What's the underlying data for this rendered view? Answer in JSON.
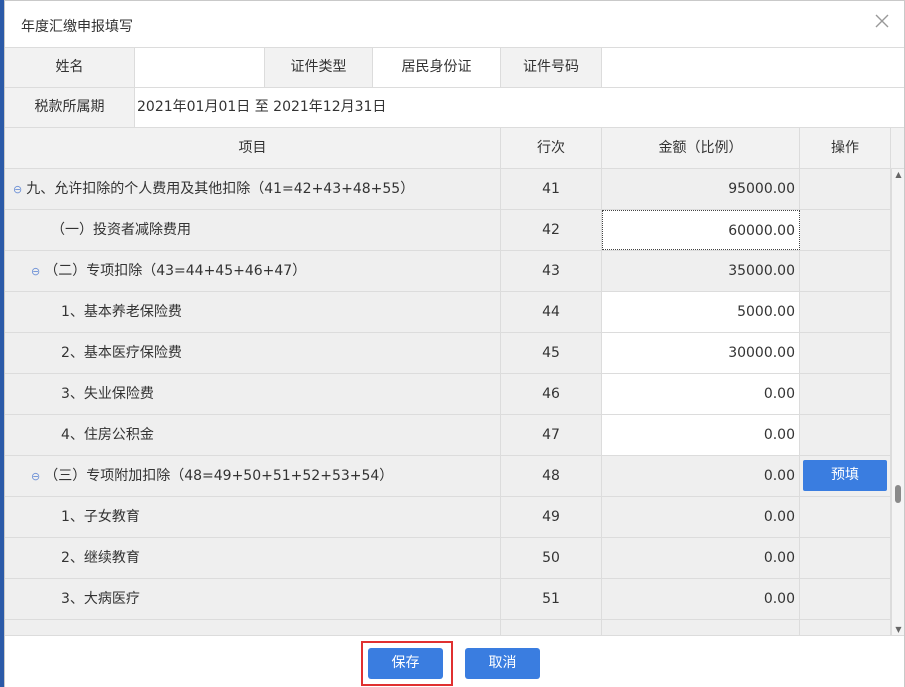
{
  "dialog": {
    "title": "年度汇缴申报填写"
  },
  "info": {
    "name_label": "姓名",
    "name_value": "",
    "id_type_label": "证件类型",
    "id_type_value": "居民身份证",
    "id_number_label": "证件号码",
    "id_number_value": "",
    "period_label": "税款所属期",
    "period_value": "2021年01月01日 至 2021年12月31日"
  },
  "grid": {
    "headers": {
      "item": "项目",
      "line": "行次",
      "amount": "金额（比例）",
      "action": "操作"
    },
    "rows": [
      {
        "item": "九、允许扣除的个人费用及其他扣除（41=42+43+48+55）",
        "line": "41",
        "amount": "95000.00"
      },
      {
        "item": "（一）投资者减除费用",
        "line": "42",
        "amount": "60000.00"
      },
      {
        "item": "（二）专项扣除（43=44+45+46+47）",
        "line": "43",
        "amount": "35000.00"
      },
      {
        "item": "1、基本养老保险费",
        "line": "44",
        "amount": "5000.00"
      },
      {
        "item": "2、基本医疗保险费",
        "line": "45",
        "amount": "30000.00"
      },
      {
        "item": "3、失业保险费",
        "line": "46",
        "amount": "0.00"
      },
      {
        "item": "4、住房公积金",
        "line": "47",
        "amount": "0.00"
      },
      {
        "item": "（三）专项附加扣除（48=49+50+51+52+53+54）",
        "line": "48",
        "amount": "0.00",
        "action": "预填"
      },
      {
        "item": "1、子女教育",
        "line": "49",
        "amount": "0.00"
      },
      {
        "item": "2、继续教育",
        "line": "50",
        "amount": "0.00"
      },
      {
        "item": "3、大病医疗",
        "line": "51",
        "amount": "0.00"
      }
    ]
  },
  "footer": {
    "save_label": "保存",
    "cancel_label": "取消"
  },
  "colors": {
    "accent": "#3a7de0",
    "highlight_border": "#e03030",
    "header_bg": "#f2f2f2"
  }
}
